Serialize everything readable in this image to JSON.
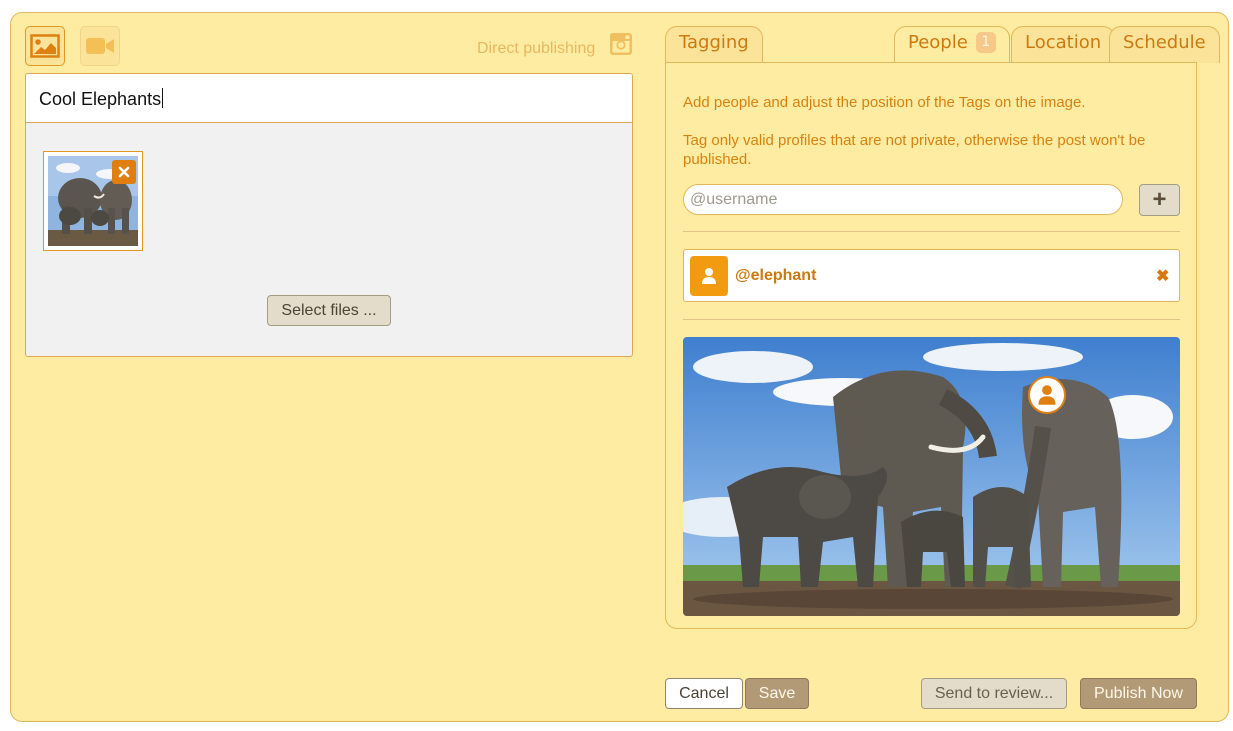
{
  "header": {
    "direct_publishing_label": "Direct publishing"
  },
  "icons": {
    "image_mode": "image-icon",
    "video_mode": "video-camera-icon",
    "platform": "instagram-icon"
  },
  "composer": {
    "title_value": "Cool Elephants",
    "select_files_label": "Select files ..."
  },
  "tabs": [
    {
      "label": "Tagging"
    },
    {
      "label": "People",
      "badge": "1"
    },
    {
      "label": "Location"
    },
    {
      "label": "Schedule"
    }
  ],
  "people": {
    "info_line1": "Add people and adjust the position of the Tags on the image.",
    "info_line2": "Tag only valid profiles that are not private, otherwise the post won't be published.",
    "username_placeholder": "@username",
    "add_label": "+",
    "tagged": [
      {
        "username": "@elephant",
        "remove_label": "✖"
      }
    ]
  },
  "footer": {
    "cancel_label": "Cancel",
    "save_label": "Save",
    "review_label": "Send to review...",
    "publish_label": "Publish Now"
  },
  "colors": {
    "background": "#fdeca2",
    "accent": "#e08010",
    "text_orange": "#d88210",
    "button_brown": "#b29a77"
  }
}
